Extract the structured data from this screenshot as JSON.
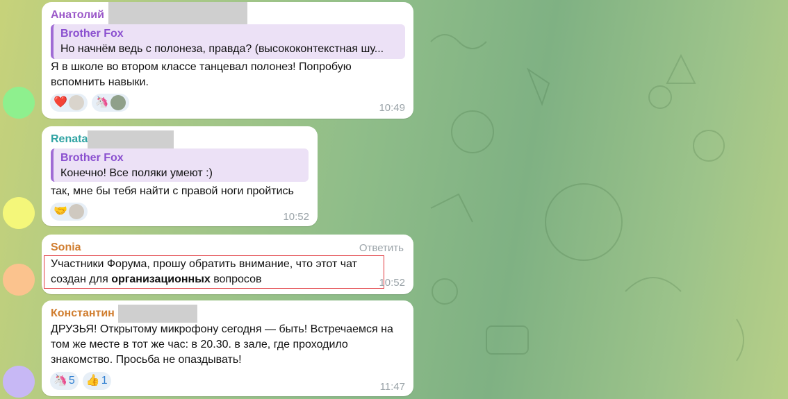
{
  "colors": {
    "author_purple": "#9b59c9",
    "author_teal": "#2fa3a3",
    "author_orange": "#d07d2f",
    "quote_accent": "#a06cd5",
    "reaction_text": "#2f7fd1",
    "highlight": "#e0353a"
  },
  "messages": [
    {
      "author": "Анатолий",
      "avatar_color": "#8ef08e",
      "quote": {
        "author": "Brother Fox",
        "text": "Но начнём ведь с полонеза, правда? (высококонтекстная шу..."
      },
      "lines": [
        "Я в школе во втором классе танцевал полонез! Попробую",
        "вспомнить навыки."
      ],
      "reactions": [
        {
          "emoji": "heart",
          "glyph": "❤️"
        },
        {
          "emoji": "unicorn",
          "glyph": "🦄"
        }
      ],
      "time": "10:49"
    },
    {
      "author": "Renata",
      "avatar_color": "#f4f77a",
      "quote": {
        "author": "Brother Fox",
        "text": "Конечно! Все поляки умеют :)"
      },
      "lines": [
        "так, мне бы тебя найти с правой ноги пройтись"
      ],
      "reactions": [
        {
          "emoji": "handshake",
          "glyph": "🤝"
        }
      ],
      "time": "10:52"
    },
    {
      "author": "Sonia",
      "avatar_color": "#fbc38e",
      "reply_label": "Ответить",
      "line1": "Участники Форума, прошу обратить внимание, что этот чат",
      "line2_pre": "создан для ",
      "line2_bold": "организационных",
      "line2_post": " вопросов",
      "time": "10:52"
    },
    {
      "author": "Константин",
      "avatar_color": "#c7b8f5",
      "lines": [
        "ДРУЗЬЯ! Открытому микрофону сегодня — быть! Встречаемся на",
        "том же месте в тот же час: в 20.30. в зале, где проходило",
        "знакомство. Просьба не опаздывать!"
      ],
      "reactions": [
        {
          "emoji": "unicorn",
          "glyph": "🦄",
          "count": "5"
        },
        {
          "emoji": "thumbs-up",
          "glyph": "👍",
          "count": "1"
        }
      ],
      "time": "11:47"
    }
  ]
}
